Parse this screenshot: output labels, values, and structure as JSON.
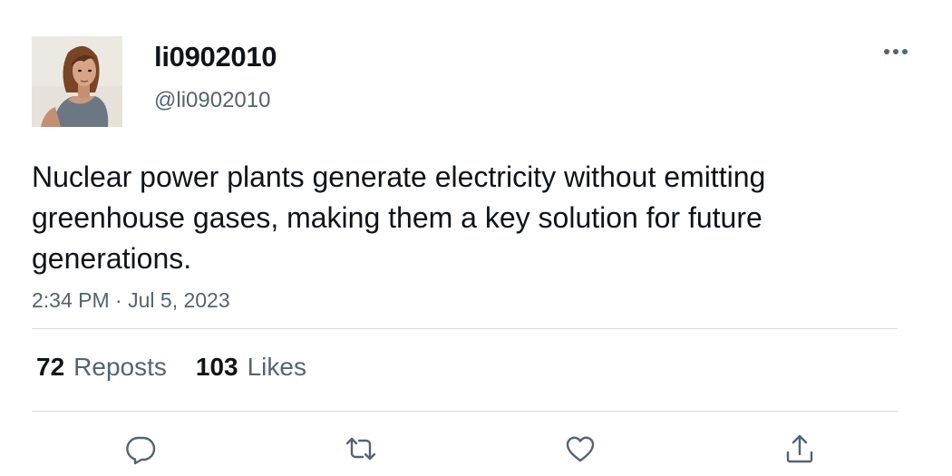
{
  "author": {
    "display_name": "li0902010",
    "handle": "@li0902010"
  },
  "tweet": {
    "text": "Nuclear power plants generate electricity without emitting greenhouse gases, making them a key solution for future generations.",
    "time": "2:34 PM",
    "separator": " · ",
    "date": "Jul 5, 2023"
  },
  "stats": {
    "reposts_count": "72",
    "reposts_label": "Reposts",
    "likes_count": "103",
    "likes_label": "Likes"
  },
  "icons": {
    "more": "more-horizontal-icon",
    "reply": "reply-icon",
    "repost": "repost-icon",
    "like": "heart-icon",
    "share": "share-icon"
  },
  "colors": {
    "text_primary": "#0f1419",
    "text_secondary": "#536471",
    "divider": "#d8dde1"
  }
}
